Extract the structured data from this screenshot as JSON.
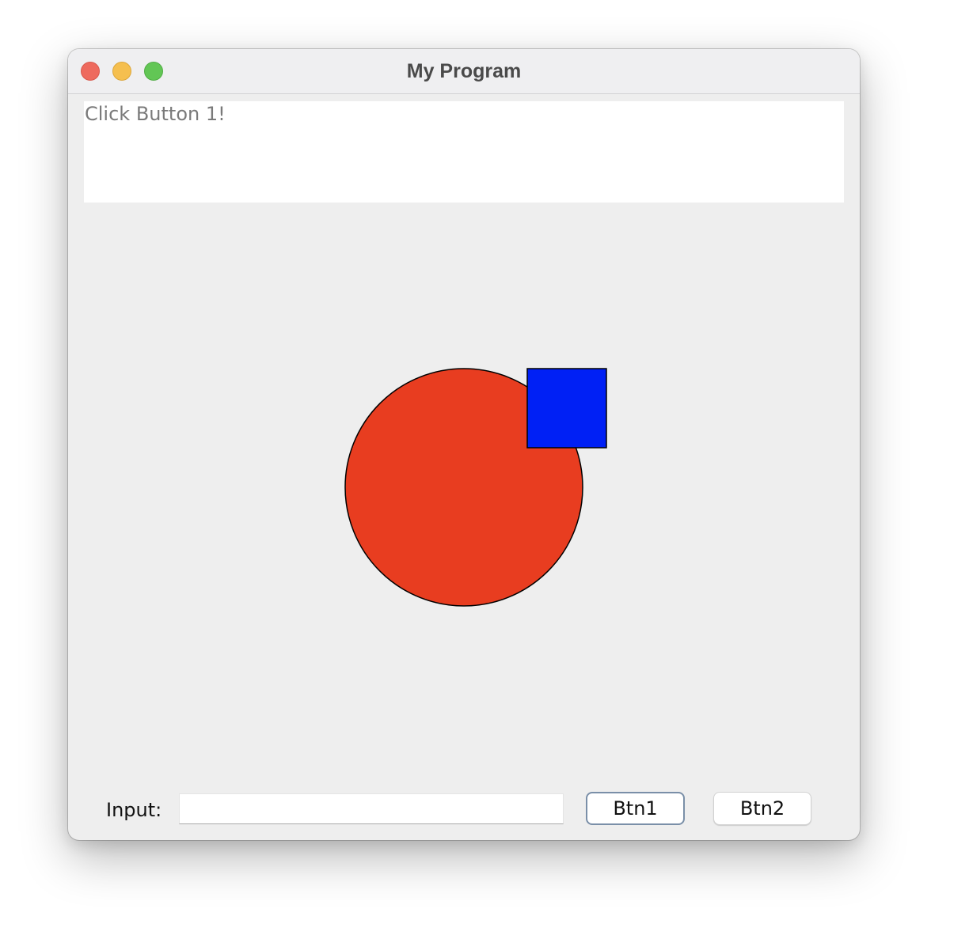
{
  "window": {
    "title": "My Program"
  },
  "output_area": {
    "text": "Click Button 1!"
  },
  "canvas": {
    "circle": {
      "fill": "#e83d20",
      "stroke": "#000000"
    },
    "square": {
      "fill": "#0020f5",
      "stroke": "#000000"
    }
  },
  "controls": {
    "input_label": "Input:",
    "input_value": "",
    "btn1_label": "Btn1",
    "btn2_label": "Btn2"
  }
}
